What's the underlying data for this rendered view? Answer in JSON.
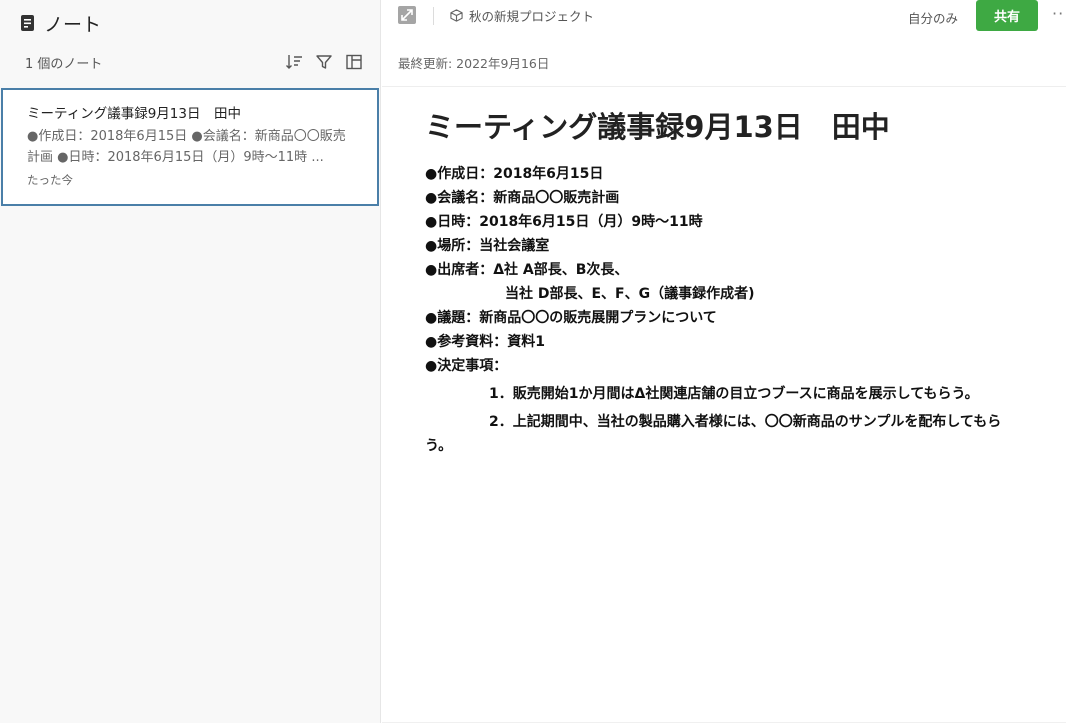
{
  "sidebar": {
    "title": "ノート",
    "title_icon": "note-icon",
    "count_label": "1 個のノート",
    "tools": [
      "sort-icon",
      "filter-icon",
      "layout-icon"
    ]
  },
  "note_list": [
    {
      "title": "ミーティング議事録9月13日　田中",
      "snippet": "●作成日：2018年6月15日 ●会議名：新商品〇〇販売計画 ●日時：2018年6月15日（月）9時〜11時 ...",
      "time": "たった今"
    }
  ],
  "topbar": {
    "project_name": "秋の新規プロジェクト",
    "visibility": "自分のみ",
    "share_label": "共有",
    "more_label": "··",
    "share_color": "#3ea943"
  },
  "editor": {
    "last_updated": "最終更新: 2022年9月16日",
    "title": "ミーティング議事録9月13日　田中",
    "lines": [
      "●作成日：2018年6月15日",
      "●会議名：新商品〇〇販売計画",
      "●日時：2018年6月15日（月）9時〜11時",
      "●場所：当社会議室",
      "●出席者：Δ社 A部長、B次長、",
      "当社 D部長、E、F、G（議事録作成者)",
      "●議題：新商品〇〇の販売展開プランについて",
      "●参考資料：資料1",
      "●決定事項：",
      "1．販売開始1か月間はΔ社関連店舗の目立つブースに商品を展示してもらう。",
      "2．上記期間中、当社の製品購入者様には、〇〇新商品のサンプルを配布してもらう。"
    ]
  }
}
